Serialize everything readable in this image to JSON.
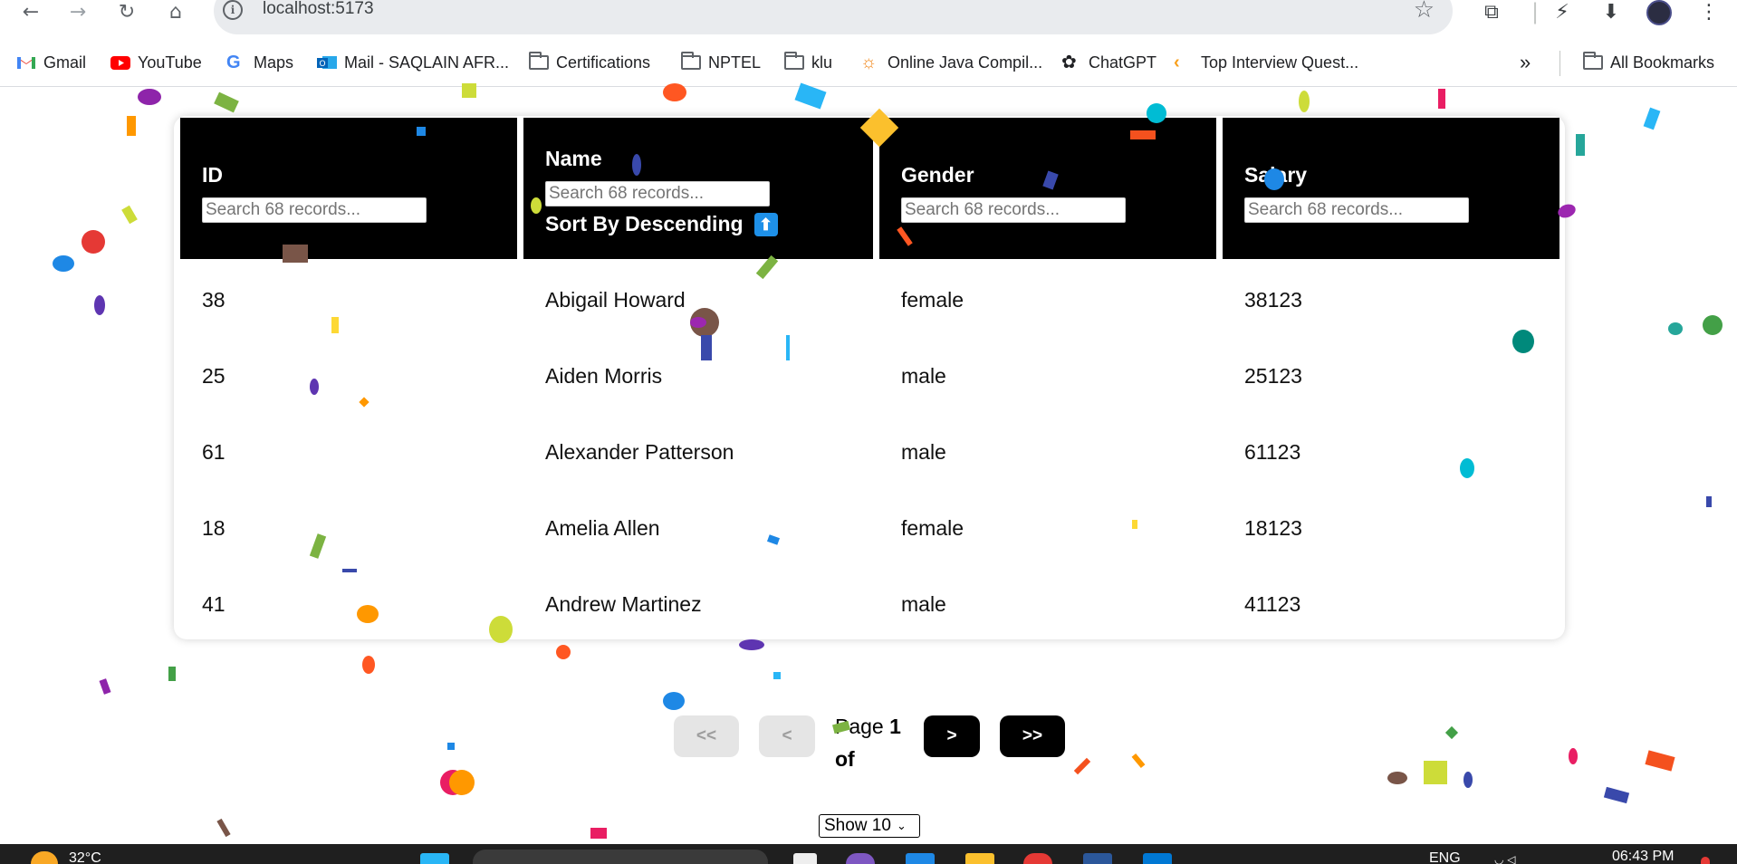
{
  "browser": {
    "url": "localhost:5173",
    "bookmarks": [
      {
        "label": "Gmail",
        "icon": "gmail-icon"
      },
      {
        "label": "YouTube",
        "icon": "youtube-icon"
      },
      {
        "label": "Maps",
        "icon": "google-icon"
      },
      {
        "label": "Mail - SAQLAIN AFR...",
        "icon": "outlook-icon"
      },
      {
        "label": "Certifications",
        "icon": "folder-icon"
      },
      {
        "label": "NPTEL",
        "icon": "folder-icon"
      },
      {
        "label": "klu",
        "icon": "folder-icon"
      },
      {
        "label": "Online Java Compil...",
        "icon": "sun-icon"
      },
      {
        "label": "ChatGPT",
        "icon": "chatgpt-icon"
      },
      {
        "label": "Top Interview Quest...",
        "icon": "leetcode-icon"
      }
    ],
    "more_bookmarks": "»",
    "all_bookmarks": "All Bookmarks"
  },
  "table": {
    "columns": [
      {
        "label": "ID",
        "placeholder": "Search 68 records..."
      },
      {
        "label": "Name",
        "placeholder": "Search 68 records...",
        "sort_label": "Sort By Descending",
        "sort_icon": "⬆"
      },
      {
        "label": "Gender",
        "placeholder": "Search 68 records..."
      },
      {
        "label": "Salary",
        "placeholder": "Search 68 records..."
      }
    ],
    "rows": [
      {
        "id": "38",
        "name": "Abigail Howard",
        "gender": "female",
        "salary": "38123"
      },
      {
        "id": "25",
        "name": "Aiden Morris",
        "gender": "male",
        "salary": "25123"
      },
      {
        "id": "61",
        "name": "Alexander Patterson",
        "gender": "male",
        "salary": "61123"
      },
      {
        "id": "18",
        "name": "Amelia Allen",
        "gender": "female",
        "salary": "18123"
      },
      {
        "id": "41",
        "name": "Andrew Martinez",
        "gender": "male",
        "salary": "41123"
      }
    ]
  },
  "pagination": {
    "first": "<<",
    "prev": "<",
    "next": ">",
    "last": ">>",
    "page_word": "Page",
    "page_number": "1",
    "of_word": "of",
    "show_select": "Show 10"
  },
  "taskbar": {
    "weather": "32°C",
    "language": "ENG",
    "time": "06:43 PM"
  }
}
